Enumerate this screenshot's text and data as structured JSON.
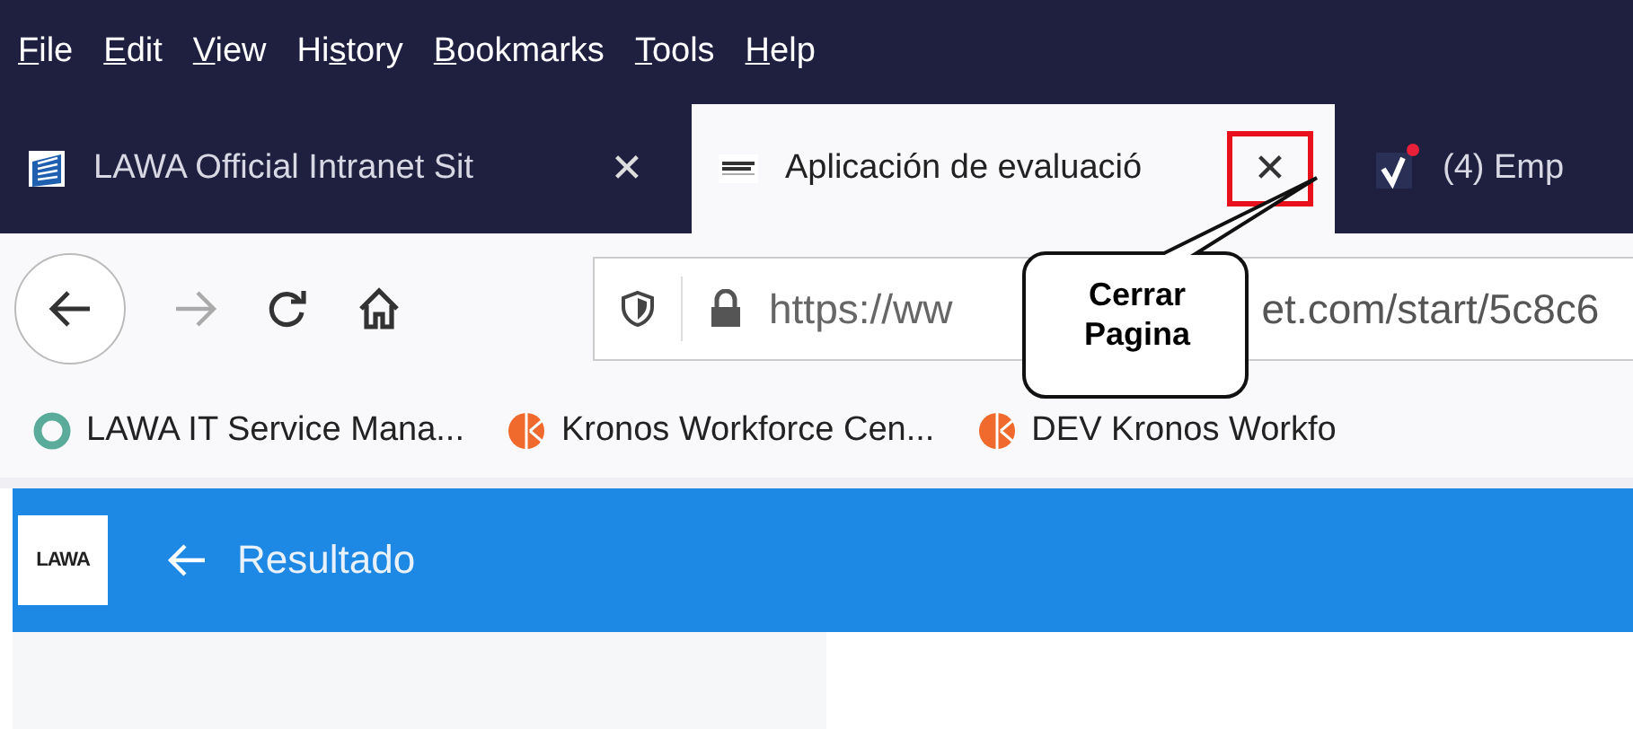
{
  "menu": [
    {
      "key": "F",
      "after": "ile"
    },
    {
      "key": "E",
      "after": "dit"
    },
    {
      "key": "V",
      "after": "iew"
    },
    {
      "before": "Hi",
      "key": "s",
      "after": "tory"
    },
    {
      "key": "B",
      "after": "ookmarks"
    },
    {
      "key": "T",
      "after": "ools"
    },
    {
      "key": "H",
      "after": "elp"
    }
  ],
  "tabs": [
    {
      "title": "LAWA Official Intranet Sit",
      "kind": "building",
      "selected": false,
      "close_highlighted": false
    },
    {
      "title": "Aplicación de evaluació",
      "kind": "lawa",
      "selected": true,
      "close_highlighted": true
    },
    {
      "title": "(4) Emp",
      "kind": "check",
      "selected": false,
      "notification": true
    }
  ],
  "close_glyph": "✕",
  "address": {
    "url_start": "https://ww",
    "url_end": "et.com/start/5c8c6"
  },
  "callout": {
    "lines": [
      "Cerrar",
      "Pagina"
    ]
  },
  "bookmarks": [
    {
      "label": "LAWA IT Service Mana...",
      "kind": "ring"
    },
    {
      "label": "Kronos Workforce Cen...",
      "kind": "kronos"
    },
    {
      "label": "DEV Kronos Workfo",
      "kind": "kronos"
    }
  ],
  "app": {
    "logo": "LAWA",
    "title": "Resultado"
  }
}
